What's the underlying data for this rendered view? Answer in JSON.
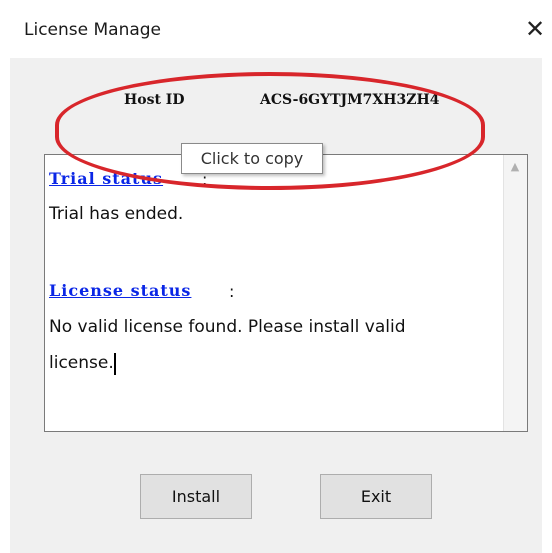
{
  "window": {
    "title": "License Manage",
    "close_glyph": "✕"
  },
  "host": {
    "label": "Host ID",
    "value": "ACS-6GYTJM7XH3ZH4"
  },
  "tooltip": {
    "text": "Click to copy"
  },
  "status_box": {
    "trial_heading": "Trial status",
    "trial_text": "Trial has ended.",
    "license_heading": "License status",
    "license_text_line1": "No valid license found. Please install valid",
    "license_text_line2": "license.",
    "colon": ":",
    "scroll_up_glyph": "▲"
  },
  "buttons": {
    "install": "Install",
    "exit": "Exit"
  },
  "colors": {
    "link": "#0a26e6",
    "annotation": "#d8262b",
    "dialog_bg": "#f0f0f0"
  }
}
